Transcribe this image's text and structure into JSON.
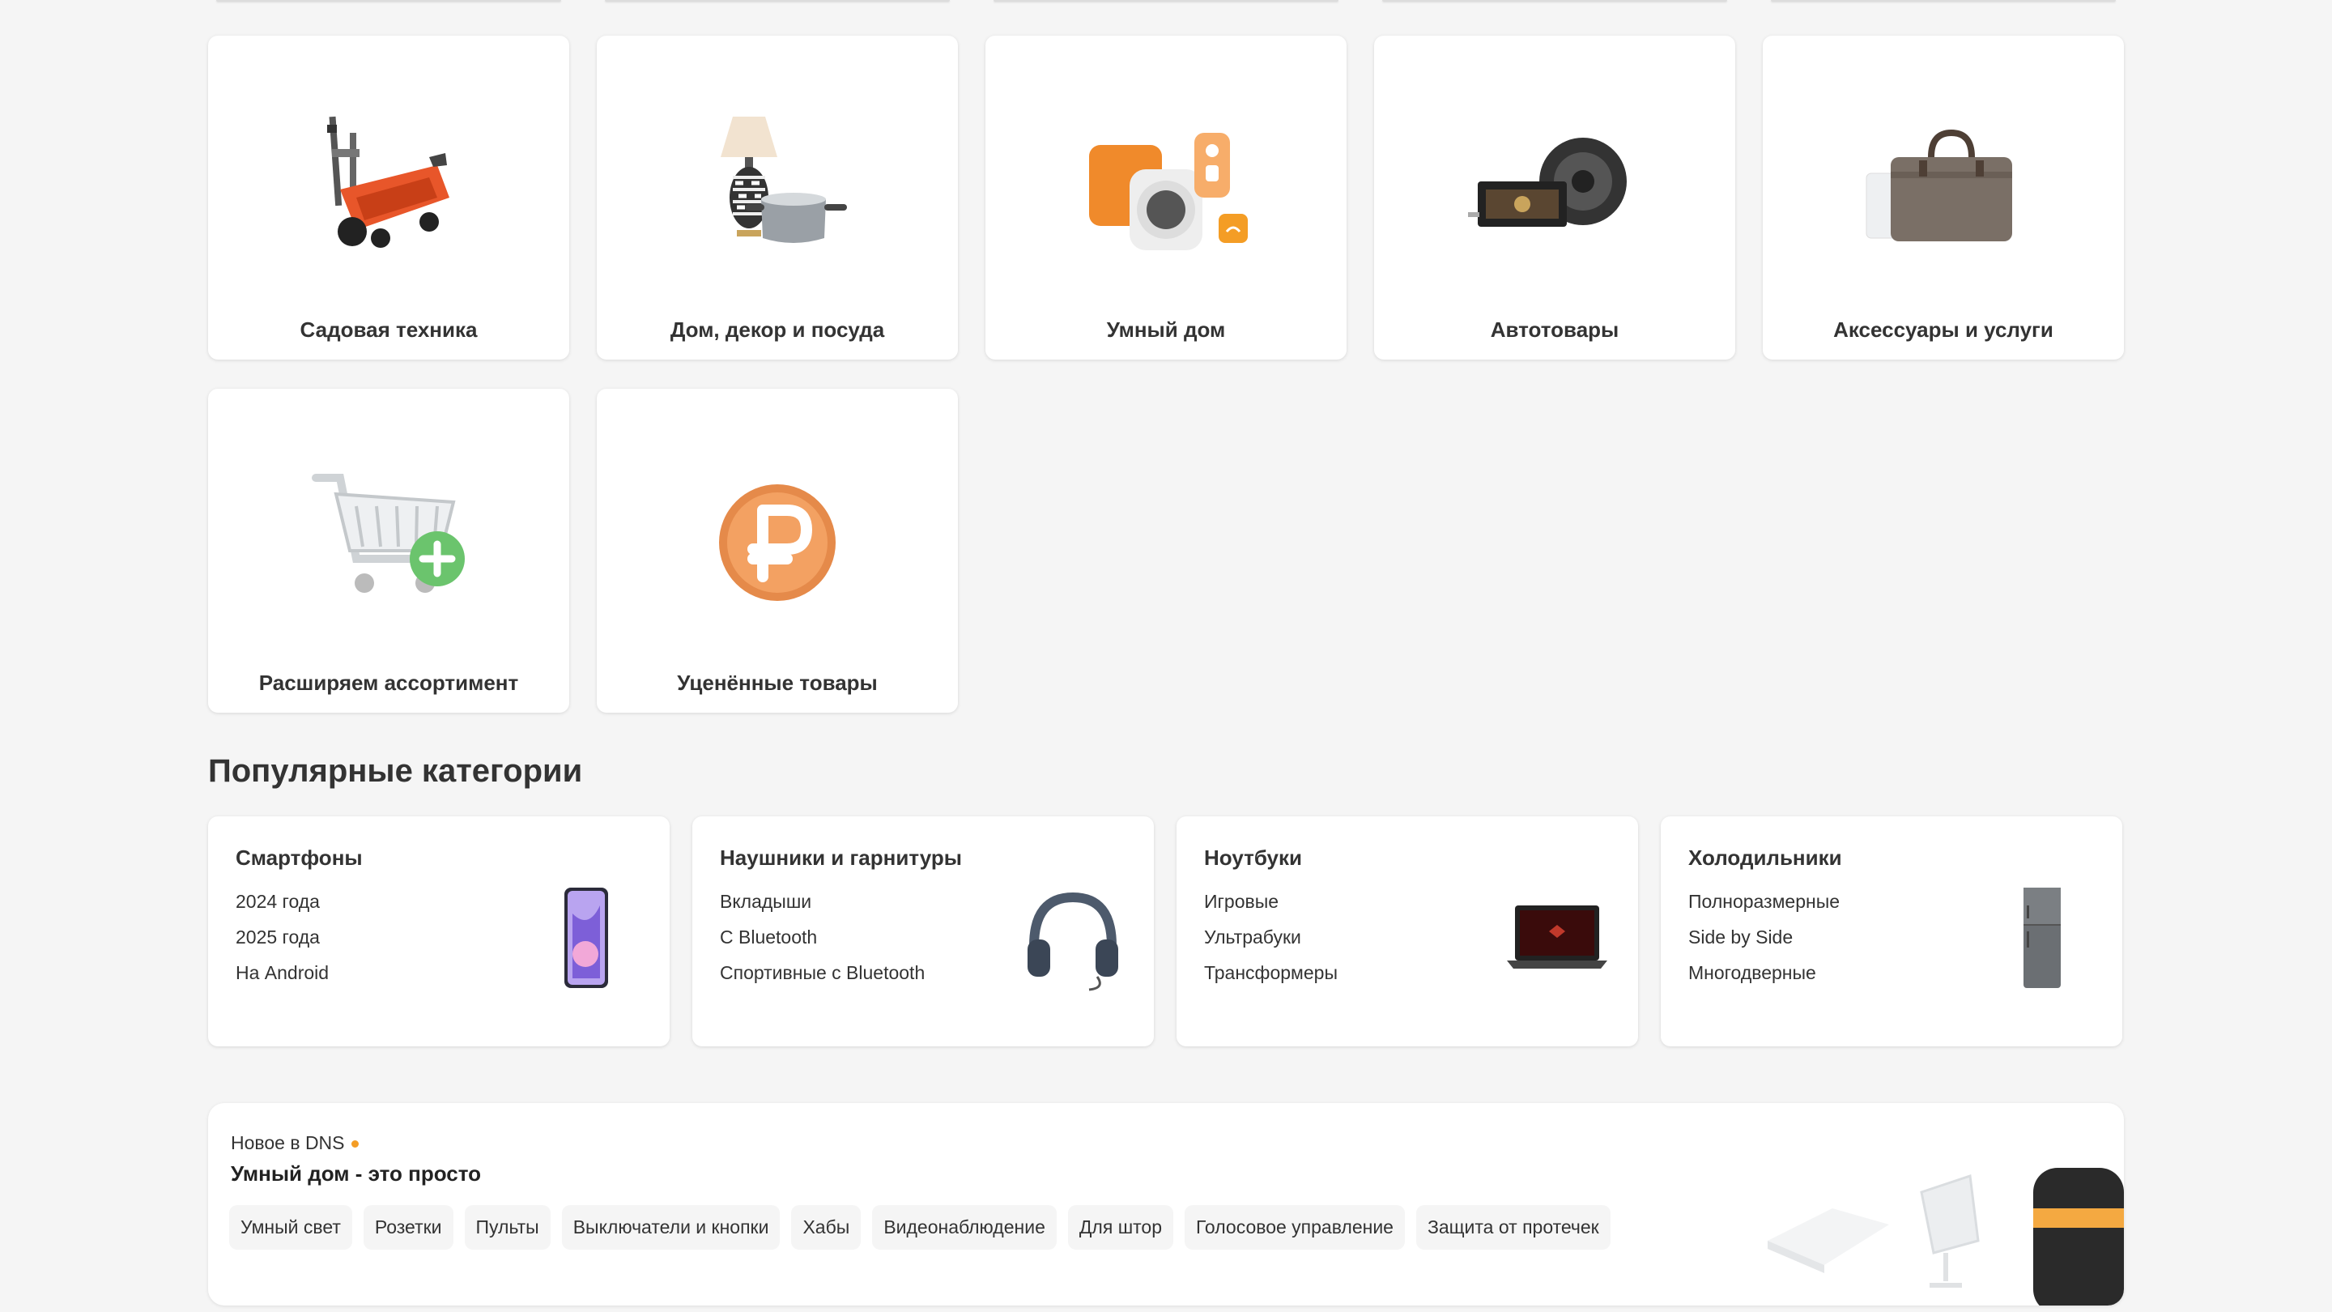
{
  "categories_row1": [
    {
      "title": "Садовая техника",
      "icon": "lawn-mower"
    },
    {
      "title": "Дом, декор и посуда",
      "icon": "lamp-and-pot"
    },
    {
      "title": "Умный дом",
      "icon": "smart-home-devices"
    },
    {
      "title": "Автотовары",
      "icon": "car-audio"
    },
    {
      "title": "Аксессуары и услуги",
      "icon": "bag"
    }
  ],
  "categories_row2": [
    {
      "title": "Расширяем ассортимент",
      "icon": "shopping-cart-plus"
    },
    {
      "title": "Уценённые товары",
      "icon": "ruble-coin"
    }
  ],
  "popular": {
    "title": "Популярные категории",
    "cards": [
      {
        "title": "Смартфоны",
        "links": [
          "2024 года",
          "2025 года",
          "На Android"
        ],
        "icon": "smartphone"
      },
      {
        "title": "Наушники и гарнитуры",
        "links": [
          "Вкладыши",
          "С Bluetooth",
          "Спортивные с Bluetooth"
        ],
        "icon": "headphones"
      },
      {
        "title": "Ноутбуки",
        "links": [
          "Игровые",
          "Ультрабуки",
          "Трансформеры"
        ],
        "icon": "laptop"
      },
      {
        "title": "Холодильники",
        "links": [
          "Полноразмерные",
          "Side by Side",
          "Многодверные"
        ],
        "icon": "fridge"
      }
    ]
  },
  "news": {
    "label": "Новое в DNS",
    "headline": "Умный дом - это просто",
    "chips": [
      "Умный свет",
      "Розетки",
      "Пульты",
      "Выключатели и кнопки",
      "Хабы",
      "Видеонаблюдение",
      "Для штор",
      "Голосовое управление",
      "Защита от протечек"
    ]
  },
  "colors": {
    "accent": "#f49d25",
    "background": "#f5f5f5",
    "card": "#ffffff"
  }
}
